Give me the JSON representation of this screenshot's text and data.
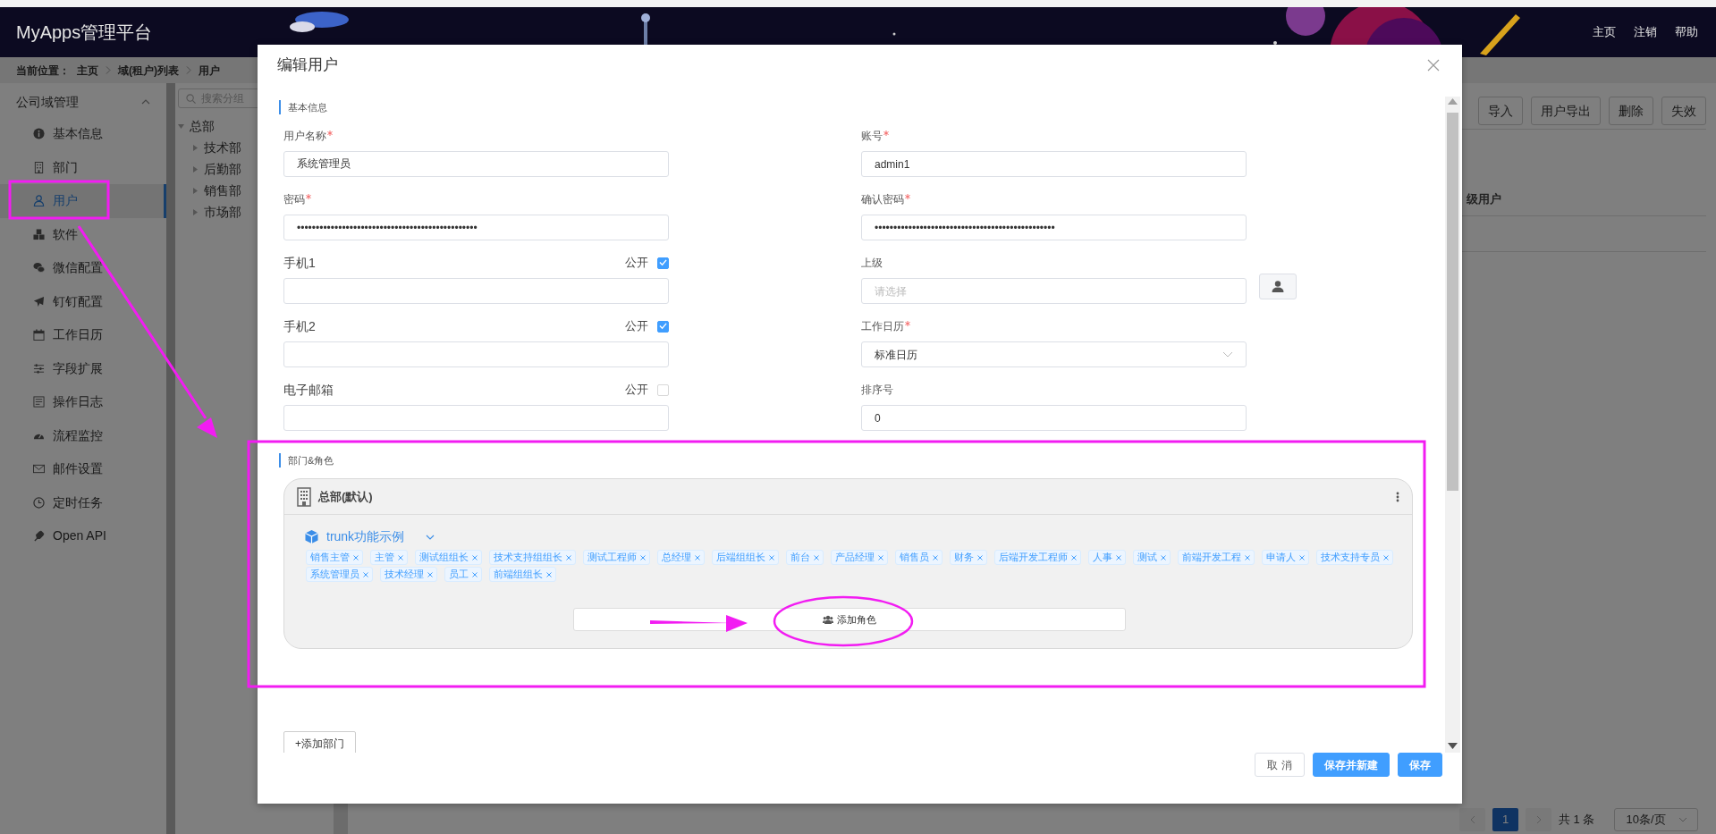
{
  "header": {
    "logo": "MyApps管理平台",
    "links": [
      "主页",
      "注销",
      "帮助"
    ]
  },
  "breadcrumb": {
    "label": "当前位置：",
    "items": [
      "主页",
      "域(租户)列表",
      "用户"
    ]
  },
  "sidebar": {
    "title": "公司域管理",
    "expanded": true,
    "items": [
      {
        "label": "基本信息",
        "selected": false
      },
      {
        "label": "部门",
        "selected": false
      },
      {
        "label": "用户",
        "selected": true
      },
      {
        "label": "软件",
        "selected": false
      },
      {
        "label": "微信配置",
        "selected": false
      },
      {
        "label": "钉钉配置",
        "selected": false
      },
      {
        "label": "工作日历",
        "selected": false
      },
      {
        "label": "字段扩展",
        "selected": false
      },
      {
        "label": "操作日志",
        "selected": false
      },
      {
        "label": "流程监控",
        "selected": false
      },
      {
        "label": "邮件设置",
        "selected": false
      },
      {
        "label": "定时任务",
        "selected": false
      },
      {
        "label": "Open API",
        "selected": false
      }
    ]
  },
  "tree": {
    "placeholder": "搜索分组",
    "root": {
      "label": "总部",
      "expanded": true,
      "children": [
        {
          "label": "技术部",
          "expanded": false
        },
        {
          "label": "后勤部",
          "expanded": false
        },
        {
          "label": "销售部",
          "expanded": false
        },
        {
          "label": "市场部",
          "expanded": false
        }
      ]
    }
  },
  "toolbar": {
    "buttons": [
      "导入",
      "用户导出",
      "删除",
      "失效"
    ]
  },
  "table": {
    "columns": [
      "级用户"
    ]
  },
  "pagination": {
    "pages": [
      {
        "label": "1",
        "selected": true
      }
    ],
    "total": "共 1 条",
    "page_size": "10条/页"
  },
  "modal": {
    "title": "编辑用户",
    "basic_section": "基本信息",
    "fields": [
      {
        "kind": "text",
        "label": "用户名称",
        "required": true,
        "value": "系统管理员"
      },
      {
        "kind": "text",
        "label": "账号",
        "required": true,
        "value": "admin1"
      },
      {
        "kind": "text",
        "label": "密码",
        "required": true,
        "value": "••••••••••••••••••••••••••••••••••••••••••••••••"
      },
      {
        "kind": "text",
        "label": "确认密码",
        "required": true,
        "value": "••••••••••••••••••••••••••••••••••••••••••••••••"
      },
      {
        "kind": "text",
        "label": "手机1",
        "required": false,
        "public_label": "公开",
        "public": true
      },
      {
        "kind": "picker",
        "label": "上级",
        "required": false,
        "placeholder": "请选择"
      },
      {
        "kind": "text",
        "label": "手机2",
        "required": false,
        "public_label": "公开",
        "public": true
      },
      {
        "kind": "select",
        "label": "工作日历",
        "required": true,
        "value": "标准日历"
      },
      {
        "kind": "text",
        "label": "电子邮箱",
        "required": false,
        "public_label": "公开",
        "public": false
      },
      {
        "kind": "text",
        "label": "排序号",
        "required": false,
        "value": "0"
      }
    ],
    "dept_section": "部门&角色",
    "departments": [
      {
        "name": "总部(默认)",
        "apps": [
          {
            "name": "trunk功能示例",
            "roles": [
              "销售主管",
              "主管",
              "测试组组长",
              "技术支持组组长",
              "测试工程师",
              "总经理",
              "后端组组长",
              "前台",
              "产品经理",
              "销售员",
              "财务",
              "后端开发工程师",
              "人事",
              "测试",
              "前端开发工程",
              "申请人",
              "技术支持专员",
              "系统管理员",
              "技术经理",
              "员工",
              "前端组组长"
            ]
          }
        ],
        "add_role": "添加角色"
      }
    ],
    "add_department": "+添加部门",
    "buttons": [
      {
        "label": "取 消",
        "kind": "default"
      },
      {
        "label": "保存并新建",
        "kind": "primary"
      },
      {
        "label": "保存",
        "kind": "primary"
      }
    ]
  }
}
